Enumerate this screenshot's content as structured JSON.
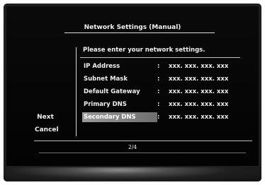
{
  "window": {
    "title": "Network Settings (Manual)"
  },
  "nav": {
    "next_label": "Next",
    "cancel_label": "Cancel"
  },
  "content": {
    "prompt": "Please enter your network settings.",
    "fields": [
      {
        "label": "IP Address",
        "value": "xxx. xxx. xxx. xxx",
        "selected": false
      },
      {
        "label": "Subnet Mask",
        "value": "xxx. xxx. xxx. xxx",
        "selected": false
      },
      {
        "label": "Default Gateway",
        "value": "xxx. xxx. xxx. xxx",
        "selected": false
      },
      {
        "label": "Primary DNS",
        "value": "xxx. xxx. xxx. xxx",
        "selected": false
      },
      {
        "label": "Secondary DNS",
        "value": "xxx. xxx. xxx. xxx",
        "selected": true
      }
    ],
    "separator": ":"
  },
  "footer": {
    "page_indicator": "2/4"
  }
}
